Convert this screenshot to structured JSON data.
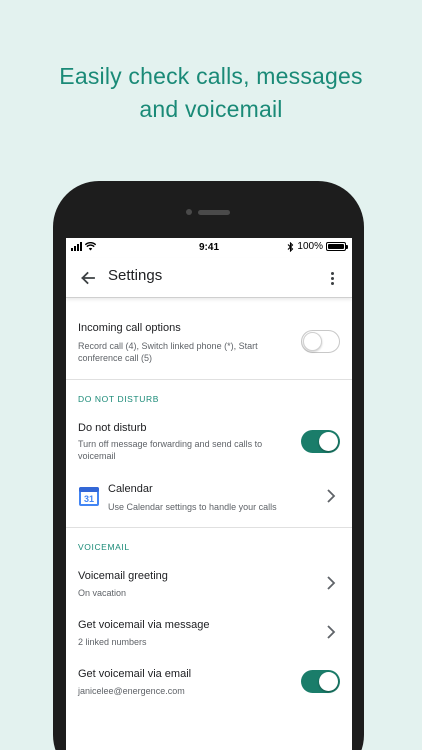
{
  "headline": {
    "line1": "Easily check calls, messages",
    "line2": "and voicemail"
  },
  "status_bar": {
    "time": "9:41",
    "battery": "100%",
    "icons": [
      "signal-icon",
      "wifi-icon",
      "bluetooth-icon",
      "battery-icon"
    ]
  },
  "app_bar": {
    "title": "Settings",
    "back_icon": "back-arrow-icon",
    "menu_icon": "more-vert-icon"
  },
  "incoming": {
    "title": "Incoming call options",
    "subtitle": "Record call (4), Switch linked phone (*), Start conference call (5)",
    "enabled": false
  },
  "dnd_section": {
    "header": "DO NOT DISTURB",
    "dnd": {
      "title": "Do not disturb",
      "subtitle": "Turn off message forwarding and send calls to voicemail",
      "enabled": true
    },
    "calendar": {
      "icon_text": "31",
      "title": "Calendar",
      "subtitle": "Use Calendar settings to handle your calls"
    }
  },
  "voicemail_section": {
    "header": "VOICEMAIL",
    "greeting": {
      "title": "Voicemail greeting",
      "subtitle": "On vacation"
    },
    "via_message": {
      "title": "Get voicemail via message",
      "subtitle": "2 linked numbers"
    },
    "via_email": {
      "title": "Get voicemail via email",
      "subtitle": "janicelee@energence.com",
      "enabled": true
    }
  },
  "colors": {
    "accent": "#1a8a77",
    "toggle_on": "#1a7d6a",
    "background": "#e3f2ef"
  }
}
